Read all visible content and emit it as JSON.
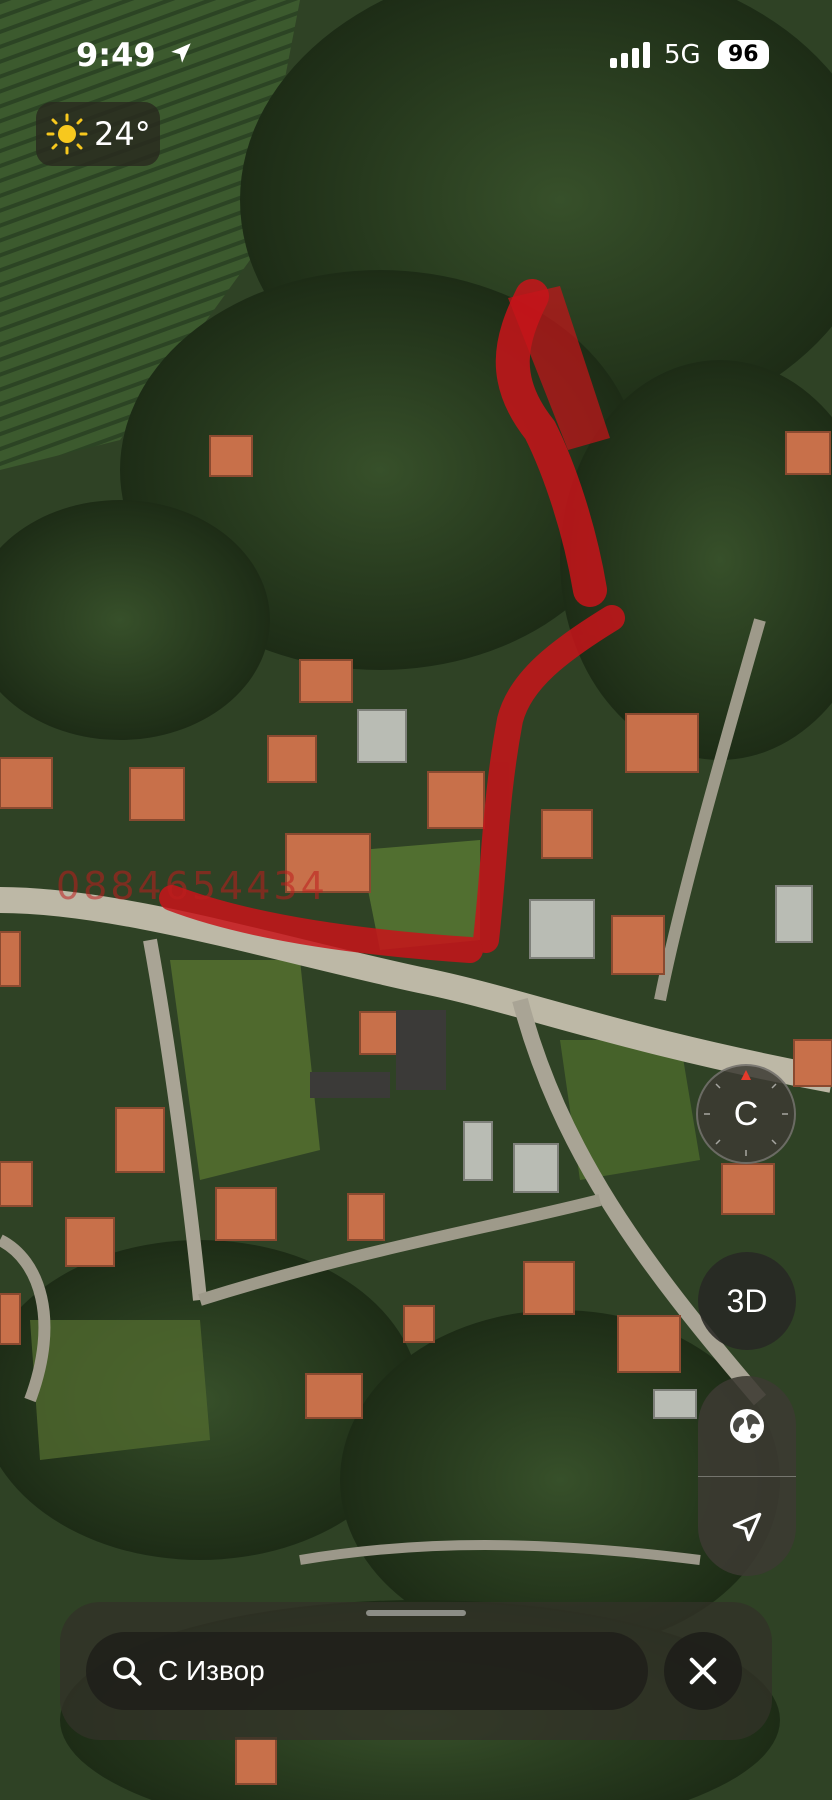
{
  "status_bar": {
    "time": "9:49",
    "network": "5G",
    "battery": "96"
  },
  "weather": {
    "temperature": "24°",
    "icon": "sun-icon"
  },
  "map": {
    "type": "satellite",
    "overlay_text": "0884654434",
    "route_color": "#c8141a"
  },
  "controls": {
    "compass_label": "C",
    "view_3d_label": "3D",
    "globe_icon": "globe-icon",
    "location_icon": "location-arrow-icon"
  },
  "search": {
    "query": "С Извор",
    "search_icon": "search-icon",
    "clear_icon": "close-icon"
  }
}
